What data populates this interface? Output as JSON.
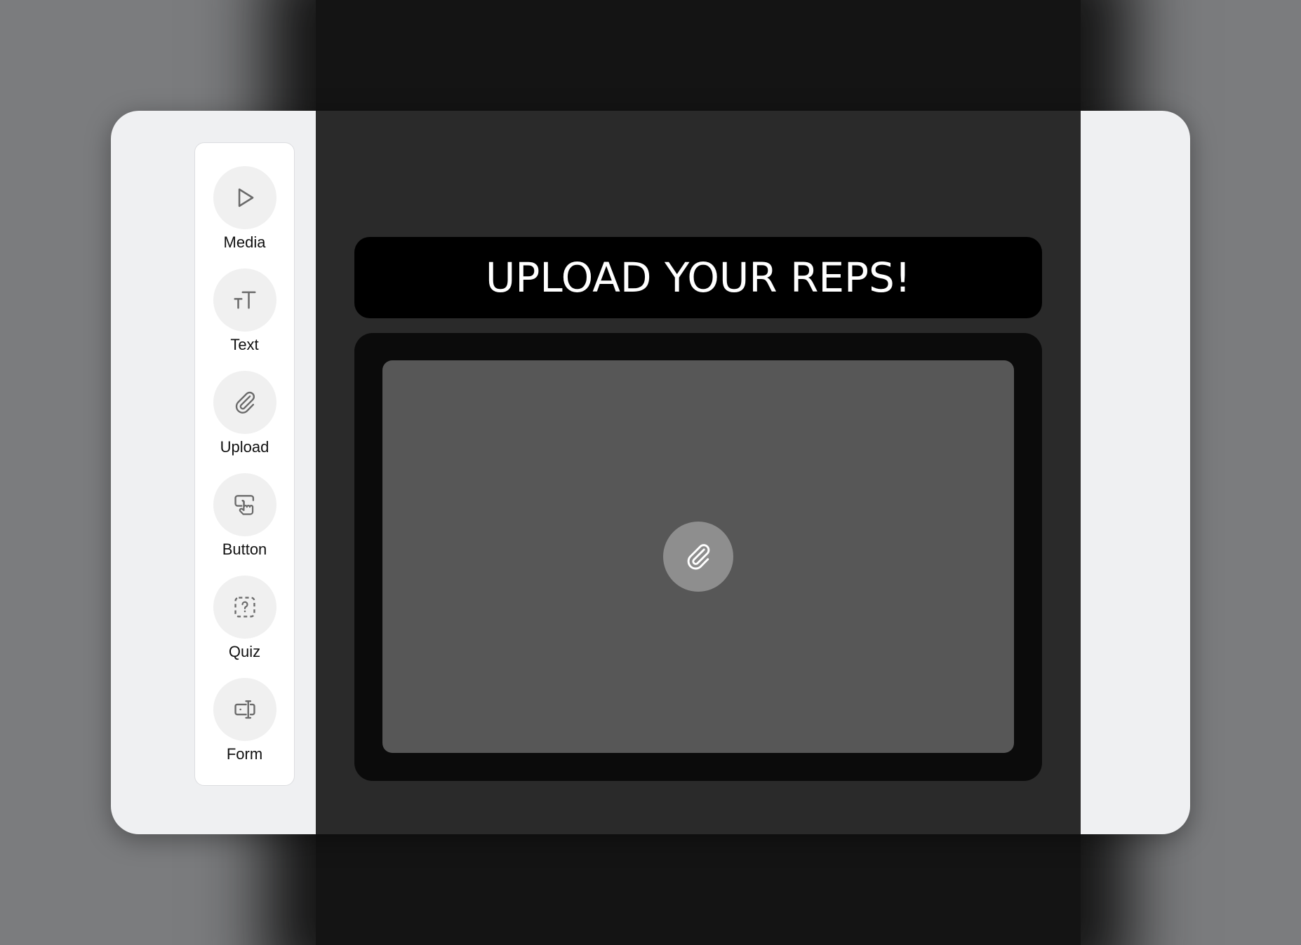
{
  "toolbar": {
    "items": [
      {
        "label": "Media",
        "icon": "play-icon"
      },
      {
        "label": "Text",
        "icon": "text-size-icon"
      },
      {
        "label": "Upload",
        "icon": "paperclip-icon"
      },
      {
        "label": "Button",
        "icon": "pointer-button-icon"
      },
      {
        "label": "Quiz",
        "icon": "question-box-icon"
      },
      {
        "label": "Form",
        "icon": "form-field-icon"
      }
    ]
  },
  "canvas": {
    "title": "UPLOAD YOUR REPS!",
    "upload_icon": "paperclip-icon"
  },
  "colors": {
    "page_background": "#7b7c7e",
    "backdrop": "#141414",
    "card_background": "#eff0f2",
    "toolbar_background": "#ffffff",
    "canvas_background": "#2a2a2a",
    "title_banner": "#000000",
    "upload_frame": "#0b0b0b",
    "upload_area": "#575757",
    "attach_button": "#8e8e8e"
  }
}
